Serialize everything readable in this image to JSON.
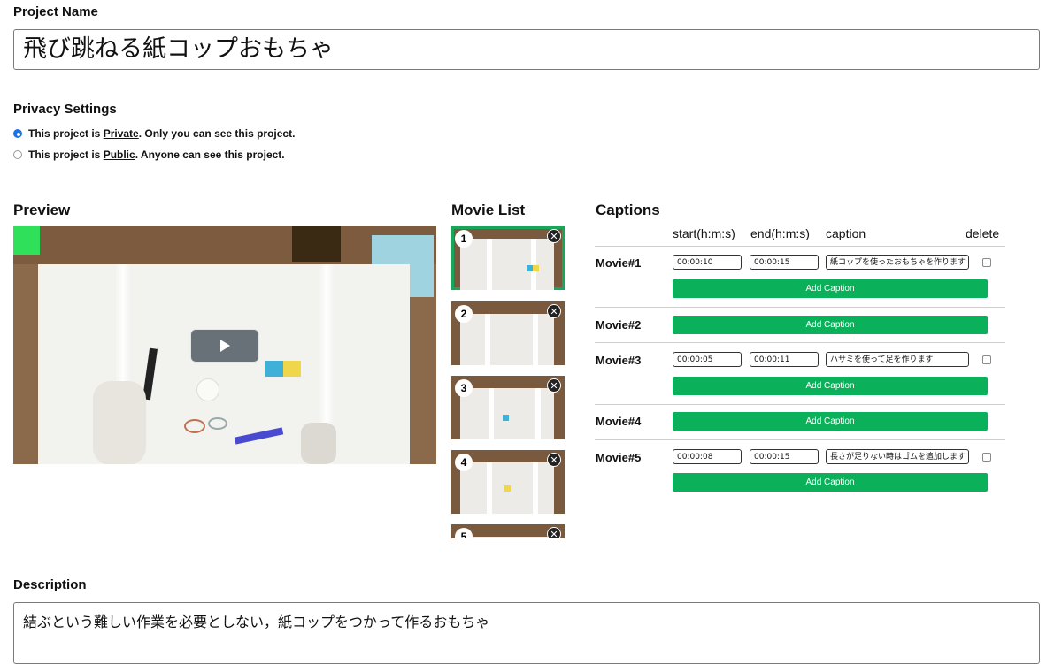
{
  "project": {
    "label": "Project Name",
    "value": "飛び跳ねる紙コップおもちゃ"
  },
  "privacy": {
    "label": "Privacy Settings",
    "options": [
      {
        "prefix": "This project is ",
        "keyword": "Private",
        "suffix": ". Only you can see this project.",
        "checked": true
      },
      {
        "prefix": "This project is ",
        "keyword": "Public",
        "suffix": ". Anyone can see this project.",
        "checked": false
      }
    ]
  },
  "preview": {
    "label": "Preview"
  },
  "movie_list": {
    "label": "Movie List",
    "items": [
      "1",
      "2",
      "3",
      "4",
      "5"
    ],
    "selected": "1"
  },
  "captions": {
    "label": "Captions",
    "columns": {
      "start": "start(h:m:s)",
      "end": "end(h:m:s)",
      "caption": "caption",
      "delete": "delete"
    },
    "add_label": "Add Caption",
    "movies": [
      {
        "name": "Movie#1",
        "captions": [
          {
            "start": "00:00:10",
            "end": "00:00:15",
            "text": "紙コップを使ったおもちゃを作ります"
          }
        ]
      },
      {
        "name": "Movie#2",
        "captions": []
      },
      {
        "name": "Movie#3",
        "captions": [
          {
            "start": "00:00:05",
            "end": "00:00:11",
            "text": "ハサミを使って足を作ります"
          }
        ]
      },
      {
        "name": "Movie#4",
        "captions": []
      },
      {
        "name": "Movie#5",
        "captions": [
          {
            "start": "00:00:08",
            "end": "00:00:15",
            "text": "長さが足りない時はゴムを追加します"
          }
        ]
      }
    ]
  },
  "description": {
    "label": "Description",
    "value": "結ぶという難しい作業を必要としない，紙コップをつかって作るおもちゃ"
  },
  "colors": {
    "accent_green": "#0ab05a",
    "radio_blue": "#1a73e8"
  }
}
